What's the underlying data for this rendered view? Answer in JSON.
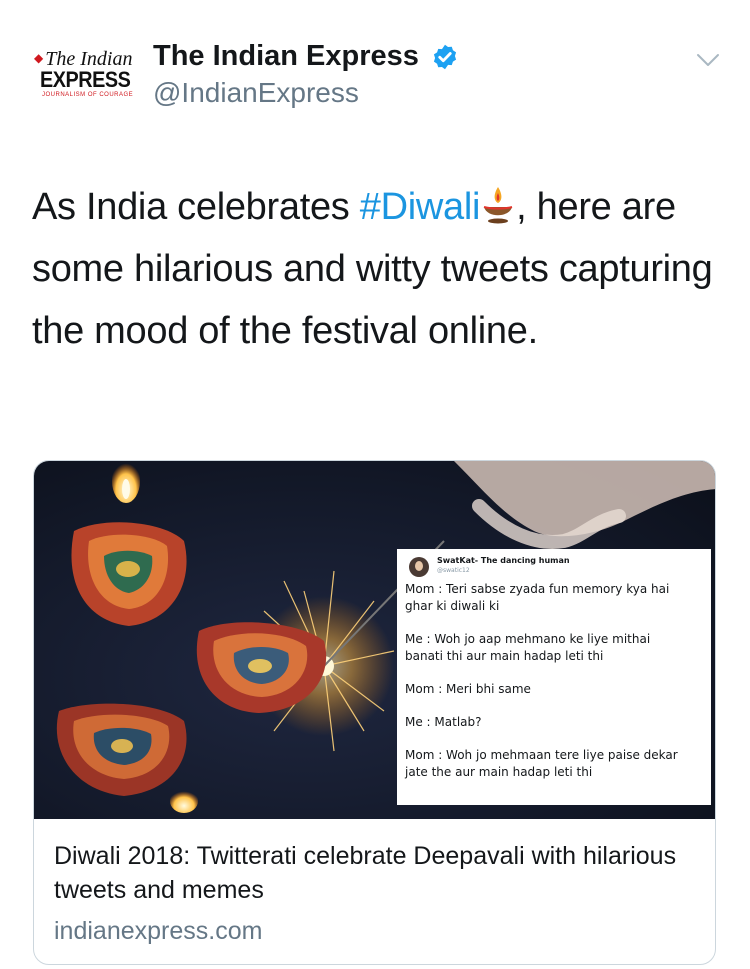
{
  "account": {
    "logo": {
      "line1": "The Indian",
      "line2": "EXPRESS",
      "tagline": "JOURNALISM OF COURAGE"
    },
    "name": "The Indian Express",
    "handle": "@IndianExpress",
    "verified": true
  },
  "tweet": {
    "text_before": "As India celebrates ",
    "hashtag": "#Diwali",
    "emoji": "diya-lamp-icon",
    "text_after": ", here are some hilarious and witty tweets capturing the mood of the festival online."
  },
  "card": {
    "image": {
      "overlay_tweet": {
        "name": "SwatKat- The dancing human",
        "handle": "@swatic12",
        "lines": [
          [
            "Mom : Teri sabse zyada fun memory kya hai",
            "ghar ki diwali ki"
          ],
          [
            "Me : Woh jo aap mehmano ke liye mithai",
            "banati thi aur main hadap leti thi"
          ],
          [
            "Mom : Meri bhi same"
          ],
          [
            "Me : Matlab?"
          ],
          [
            "Mom : Woh jo mehmaan tere liye paise dekar",
            "jate the aur main hadap leti thi"
          ]
        ]
      }
    },
    "title": "Diwali 2018: Twitterati celebrate Deepavali with hilarious tweets and memes",
    "domain": "indianexpress.com"
  },
  "colors": {
    "link": "#1b95e0",
    "secondary_text": "#657786",
    "border": "#ccd6dd"
  }
}
